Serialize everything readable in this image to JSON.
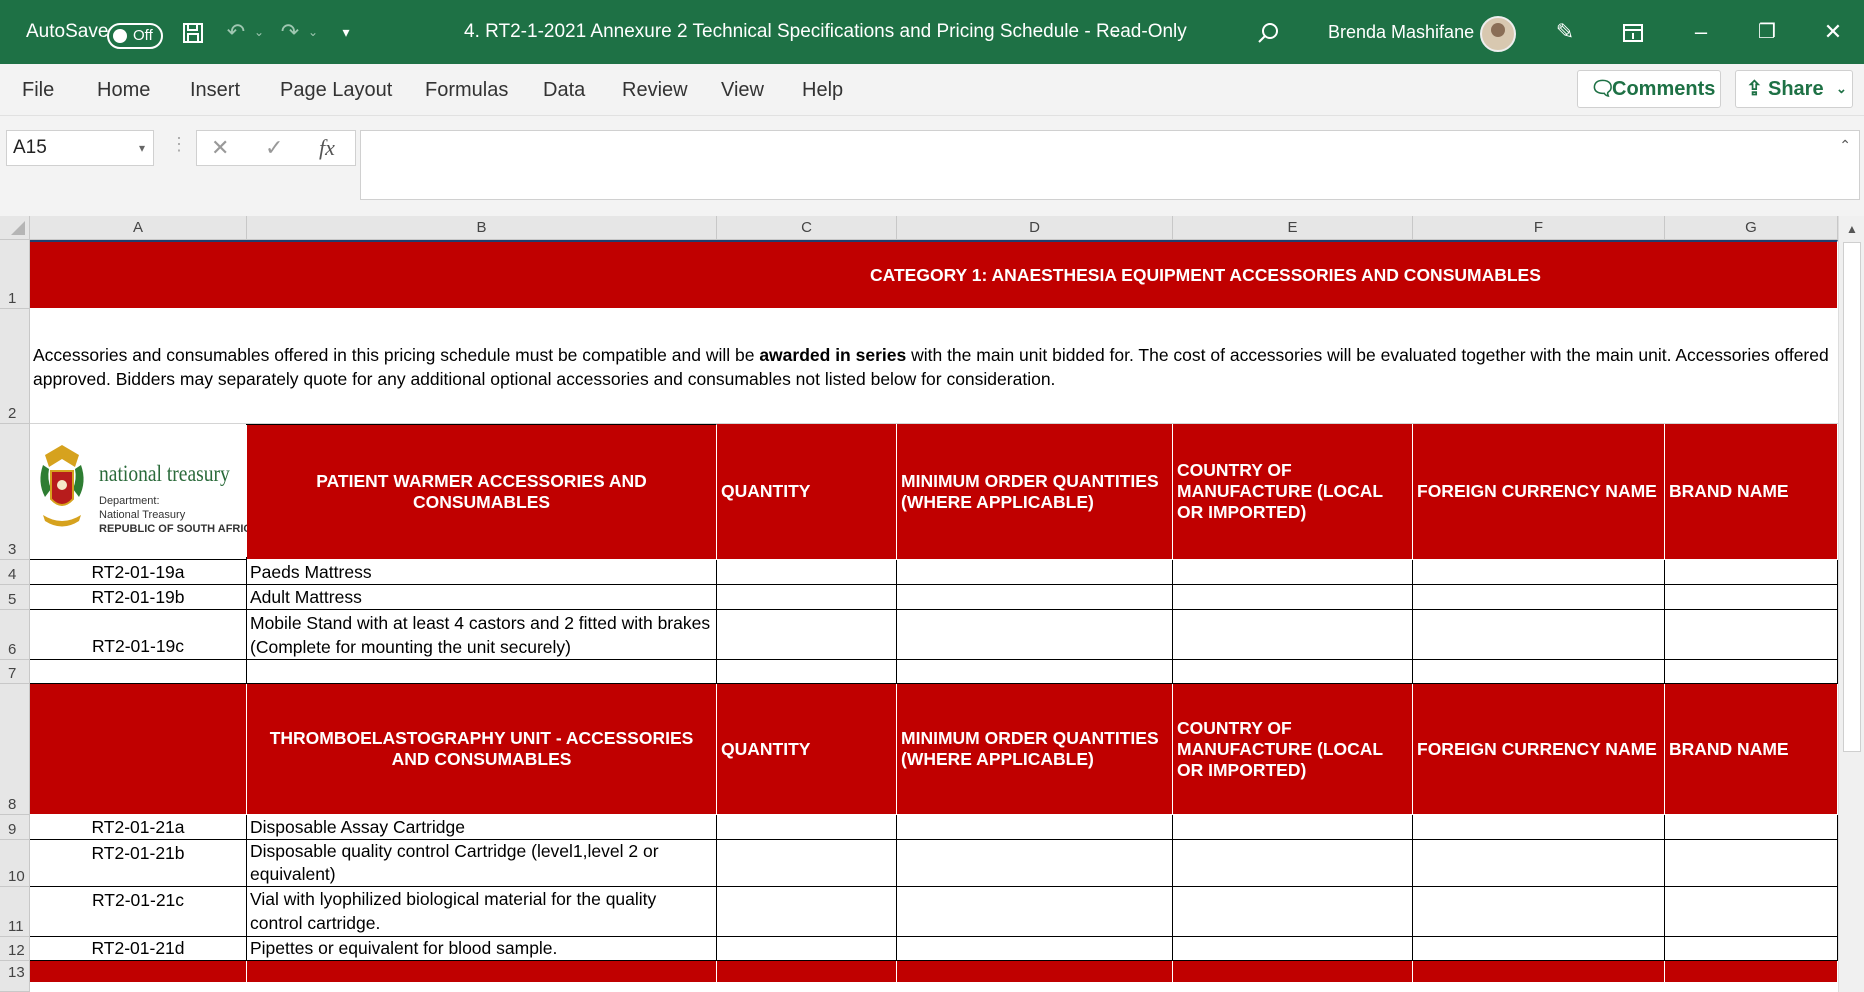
{
  "window": {
    "autosave_label": "AutoSave",
    "autosave_state": "Off",
    "title": "4. RT2-1-2021 Annexure 2 Technical Specifications and Pricing Schedule  -  Read-Only",
    "user_name": "Brenda Mashifane"
  },
  "ribbon": {
    "tabs": [
      "File",
      "Home",
      "Insert",
      "Page Layout",
      "Formulas",
      "Data",
      "Review",
      "View",
      "Help"
    ],
    "comments_label": "Comments",
    "share_label": "Share"
  },
  "formula_bar": {
    "name_box": "A15",
    "fx_label": "fx",
    "value": ""
  },
  "grid": {
    "columns": [
      "A",
      "B",
      "C",
      "D",
      "E",
      "F",
      "G"
    ],
    "rows": [
      "1",
      "2",
      "3",
      "4",
      "5",
      "6",
      "7",
      "8",
      "9",
      "10",
      "11",
      "12",
      "13"
    ],
    "category_title": "CATEGORY 1: ANAESTHESIA EQUIPMENT ACCESSORIES AND CONSUMABLES",
    "note_part1": "Accessories and consumables offered in this pricing schedule must be compatible  and will be ",
    "note_bold": "awarded in series",
    "note_part2": " with the main unit bidded for. The cost of accessories will be evaluated together with the main unit. Accessories offered",
    "note_line2": "approved. Bidders may separately quote for any additional optional accessories and consumables not listed below for consideration.",
    "logo": {
      "name": "national treasury",
      "line1": "Department:",
      "line2": "National Treasury",
      "line3": "REPUBLIC OF SOUTH AFRICA"
    },
    "header1": {
      "b": "PATIENT WARMER ACCESSORIES AND CONSUMABLES",
      "c": "QUANTITY",
      "d": "MINIMUM ORDER QUANTITIES (WHERE APPLICABLE)",
      "e": "COUNTRY OF MANUFACTURE  (LOCAL OR IMPORTED)",
      "f": "FOREIGN CURRENCY NAME",
      "g": "BRAND NAME"
    },
    "header2": {
      "b": "THROMBOELASTOGRAPHY UNIT - ACCESSORIES AND CONSUMABLES",
      "c": "QUANTITY",
      "d": "MINIMUM ORDER QUANTITIES (WHERE APPLICABLE)",
      "e": "COUNTRY OF MANUFACTURE  (LOCAL OR IMPORTED)",
      "f": "FOREIGN CURRENCY NAME",
      "g": "BRAND NAME"
    },
    "items": [
      {
        "code": "RT2-01-19a",
        "desc": "Paeds Mattress"
      },
      {
        "code": "RT2-01-19b",
        "desc": "Adult Mattress"
      },
      {
        "code": "RT2-01-19c",
        "desc": "Mobile Stand with at least 4 castors and 2 fitted with brakes (Complete for mounting the unit securely)"
      },
      {
        "code": "RT2-01-21a",
        "desc": "Disposable Assay Cartridge"
      },
      {
        "code": "RT2-01-21b",
        "desc": "Disposable quality control Cartridge (level1,level 2 or equivalent)"
      },
      {
        "code": "RT2-01-21c",
        "desc": "Vial with lyophilized biological material for the quality control cartridge."
      },
      {
        "code": "RT2-01-21d",
        "desc": "Pipettes  or equivalent for blood sample."
      }
    ]
  },
  "colors": {
    "title_bar": "#1e7145",
    "header_red": "#c00000"
  }
}
